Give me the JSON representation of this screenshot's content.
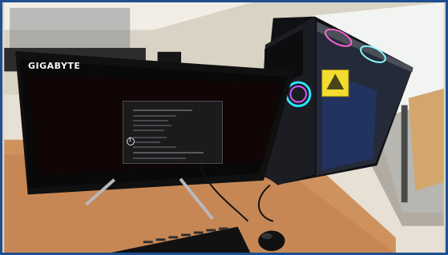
{
  "photo": {
    "monitor_brand": "GIGABYTE"
  }
}
